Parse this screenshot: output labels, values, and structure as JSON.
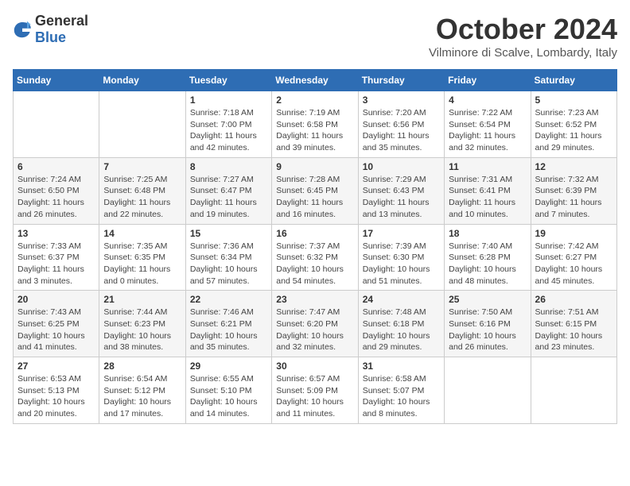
{
  "header": {
    "logo": {
      "general": "General",
      "blue": "Blue"
    },
    "month": "October 2024",
    "location": "Vilminore di Scalve, Lombardy, Italy"
  },
  "days_of_week": [
    "Sunday",
    "Monday",
    "Tuesday",
    "Wednesday",
    "Thursday",
    "Friday",
    "Saturday"
  ],
  "weeks": [
    [
      {
        "day": "",
        "info": ""
      },
      {
        "day": "",
        "info": ""
      },
      {
        "day": "1",
        "info": "Sunrise: 7:18 AM\nSunset: 7:00 PM\nDaylight: 11 hours and 42 minutes."
      },
      {
        "day": "2",
        "info": "Sunrise: 7:19 AM\nSunset: 6:58 PM\nDaylight: 11 hours and 39 minutes."
      },
      {
        "day": "3",
        "info": "Sunrise: 7:20 AM\nSunset: 6:56 PM\nDaylight: 11 hours and 35 minutes."
      },
      {
        "day": "4",
        "info": "Sunrise: 7:22 AM\nSunset: 6:54 PM\nDaylight: 11 hours and 32 minutes."
      },
      {
        "day": "5",
        "info": "Sunrise: 7:23 AM\nSunset: 6:52 PM\nDaylight: 11 hours and 29 minutes."
      }
    ],
    [
      {
        "day": "6",
        "info": "Sunrise: 7:24 AM\nSunset: 6:50 PM\nDaylight: 11 hours and 26 minutes."
      },
      {
        "day": "7",
        "info": "Sunrise: 7:25 AM\nSunset: 6:48 PM\nDaylight: 11 hours and 22 minutes."
      },
      {
        "day": "8",
        "info": "Sunrise: 7:27 AM\nSunset: 6:47 PM\nDaylight: 11 hours and 19 minutes."
      },
      {
        "day": "9",
        "info": "Sunrise: 7:28 AM\nSunset: 6:45 PM\nDaylight: 11 hours and 16 minutes."
      },
      {
        "day": "10",
        "info": "Sunrise: 7:29 AM\nSunset: 6:43 PM\nDaylight: 11 hours and 13 minutes."
      },
      {
        "day": "11",
        "info": "Sunrise: 7:31 AM\nSunset: 6:41 PM\nDaylight: 11 hours and 10 minutes."
      },
      {
        "day": "12",
        "info": "Sunrise: 7:32 AM\nSunset: 6:39 PM\nDaylight: 11 hours and 7 minutes."
      }
    ],
    [
      {
        "day": "13",
        "info": "Sunrise: 7:33 AM\nSunset: 6:37 PM\nDaylight: 11 hours and 3 minutes."
      },
      {
        "day": "14",
        "info": "Sunrise: 7:35 AM\nSunset: 6:35 PM\nDaylight: 11 hours and 0 minutes."
      },
      {
        "day": "15",
        "info": "Sunrise: 7:36 AM\nSunset: 6:34 PM\nDaylight: 10 hours and 57 minutes."
      },
      {
        "day": "16",
        "info": "Sunrise: 7:37 AM\nSunset: 6:32 PM\nDaylight: 10 hours and 54 minutes."
      },
      {
        "day": "17",
        "info": "Sunrise: 7:39 AM\nSunset: 6:30 PM\nDaylight: 10 hours and 51 minutes."
      },
      {
        "day": "18",
        "info": "Sunrise: 7:40 AM\nSunset: 6:28 PM\nDaylight: 10 hours and 48 minutes."
      },
      {
        "day": "19",
        "info": "Sunrise: 7:42 AM\nSunset: 6:27 PM\nDaylight: 10 hours and 45 minutes."
      }
    ],
    [
      {
        "day": "20",
        "info": "Sunrise: 7:43 AM\nSunset: 6:25 PM\nDaylight: 10 hours and 41 minutes."
      },
      {
        "day": "21",
        "info": "Sunrise: 7:44 AM\nSunset: 6:23 PM\nDaylight: 10 hours and 38 minutes."
      },
      {
        "day": "22",
        "info": "Sunrise: 7:46 AM\nSunset: 6:21 PM\nDaylight: 10 hours and 35 minutes."
      },
      {
        "day": "23",
        "info": "Sunrise: 7:47 AM\nSunset: 6:20 PM\nDaylight: 10 hours and 32 minutes."
      },
      {
        "day": "24",
        "info": "Sunrise: 7:48 AM\nSunset: 6:18 PM\nDaylight: 10 hours and 29 minutes."
      },
      {
        "day": "25",
        "info": "Sunrise: 7:50 AM\nSunset: 6:16 PM\nDaylight: 10 hours and 26 minutes."
      },
      {
        "day": "26",
        "info": "Sunrise: 7:51 AM\nSunset: 6:15 PM\nDaylight: 10 hours and 23 minutes."
      }
    ],
    [
      {
        "day": "27",
        "info": "Sunrise: 6:53 AM\nSunset: 5:13 PM\nDaylight: 10 hours and 20 minutes."
      },
      {
        "day": "28",
        "info": "Sunrise: 6:54 AM\nSunset: 5:12 PM\nDaylight: 10 hours and 17 minutes."
      },
      {
        "day": "29",
        "info": "Sunrise: 6:55 AM\nSunset: 5:10 PM\nDaylight: 10 hours and 14 minutes."
      },
      {
        "day": "30",
        "info": "Sunrise: 6:57 AM\nSunset: 5:09 PM\nDaylight: 10 hours and 11 minutes."
      },
      {
        "day": "31",
        "info": "Sunrise: 6:58 AM\nSunset: 5:07 PM\nDaylight: 10 hours and 8 minutes."
      },
      {
        "day": "",
        "info": ""
      },
      {
        "day": "",
        "info": ""
      }
    ]
  ]
}
